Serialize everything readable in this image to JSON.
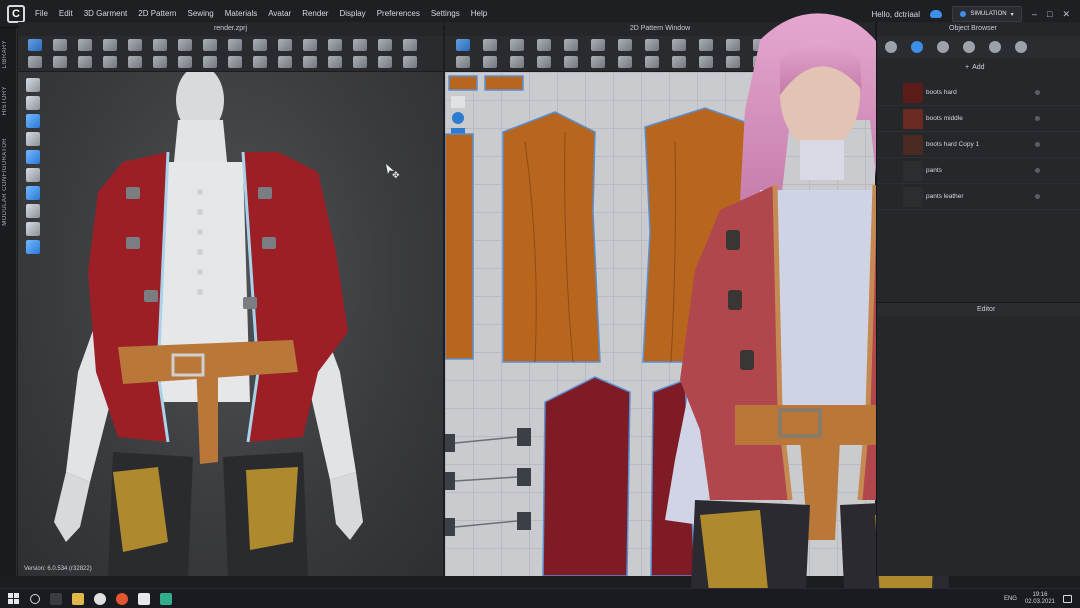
{
  "menu": {
    "items": [
      "File",
      "Edit",
      "3D Garment",
      "2D Pattern",
      "Sewing",
      "Materials",
      "Avatar",
      "Render",
      "Display",
      "Preferences",
      "Settings",
      "Help"
    ],
    "hello": "Hello, dctriaal",
    "mode": "SIMULATION",
    "logo_letter": "C"
  },
  "left_tabs": [
    "LIBRARY",
    "HISTORY",
    "MODULAR CONFIGURATOR"
  ],
  "window3d": {
    "title": "render.zprj",
    "version": "Version: 6.0.534 (r32822)"
  },
  "window2d": {
    "title": "2D Pattern Window"
  },
  "object_browser": {
    "title": "Object Browser",
    "add_label": "Add",
    "items": [
      {
        "label": "boots hard",
        "swatch": "#5a1d1a"
      },
      {
        "label": "boots middle",
        "swatch": "#6a2a22"
      },
      {
        "label": "boots hard Copy 1",
        "swatch": "#4a2a20"
      },
      {
        "label": "pants",
        "swatch": "#2c2d30"
      },
      {
        "label": "pants leather",
        "swatch": "#2c2d30"
      }
    ],
    "editor_title": "Editor"
  },
  "taskbar": {
    "lang": "ENG",
    "time": "19:16",
    "date": "02.03.2021"
  },
  "colors": {
    "accent": "#3d8ee8",
    "jacket_red": "#9c1f26",
    "pattern_orange": "#b8651e",
    "belt_tan": "#b9773a"
  }
}
